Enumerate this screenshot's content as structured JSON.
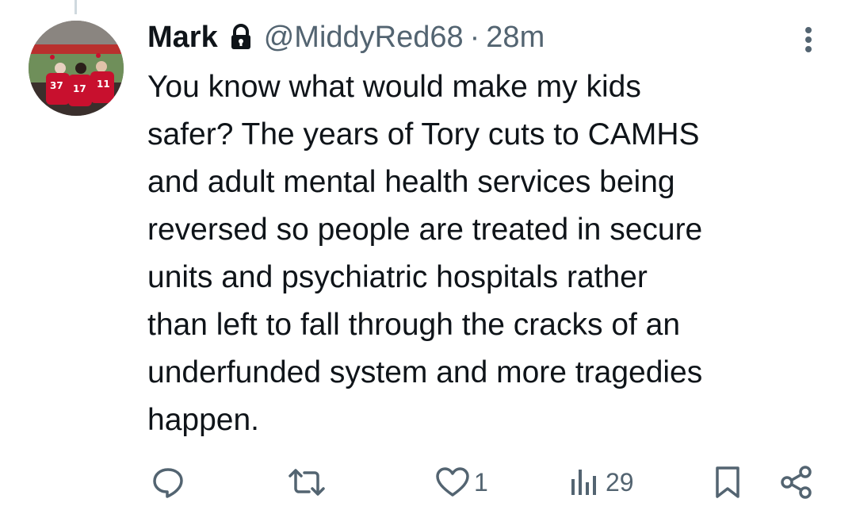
{
  "tweet": {
    "author_name": "Mark",
    "handle": "@MiddyRed68",
    "separator": "·",
    "time": "28m",
    "protected": true,
    "text": "You know what would make my kids\nsafer? The years of Tory cuts to CAMHS\nand adult mental health services being\nreversed so people are treated in secure\nunits and psychiatric hospitals rather\nthan left to fall through the cracks of an\nunderfunded system and more tragedies\nhappen.",
    "avatar": {
      "description_icon": "football-players-avatar",
      "shirt_numbers": [
        "37",
        "17",
        "11"
      ]
    }
  },
  "actions": {
    "reply": {
      "icon": "reply-icon",
      "count": ""
    },
    "retweet": {
      "icon": "retweet-icon",
      "count": ""
    },
    "like": {
      "icon": "heart-icon",
      "count": "1"
    },
    "views": {
      "icon": "views-icon",
      "count": "29"
    },
    "bookmark": {
      "icon": "bookmark-icon"
    },
    "share": {
      "icon": "share-icon"
    }
  },
  "colors": {
    "text": "#0f1419",
    "secondary": "#536471",
    "thread_line": "#cfd9de",
    "shirt_red": "#c8102e"
  }
}
